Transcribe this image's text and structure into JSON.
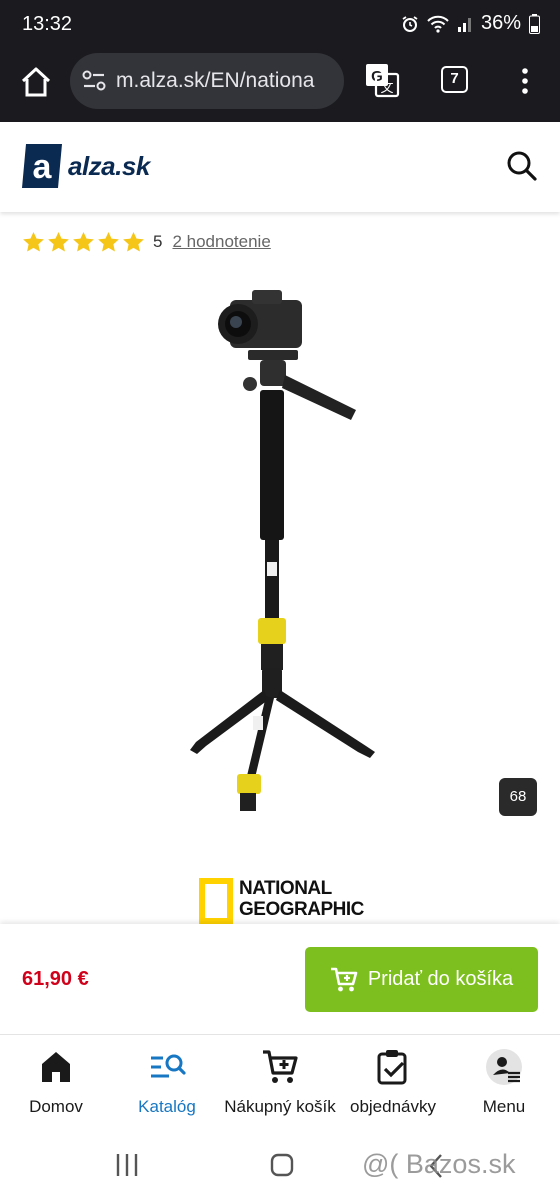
{
  "status_bar": {
    "time": "13:32",
    "battery": "36%",
    "icons": [
      "alarm-icon",
      "wifi-icon",
      "signal-icon",
      "battery-icon"
    ]
  },
  "browser": {
    "url": "m.alza.sk/EN/nationa",
    "tab_count": "7",
    "icons": [
      "home-icon",
      "site-settings-icon",
      "translate-icon",
      "more-vert-icon"
    ]
  },
  "site": {
    "logo_text": "alza.sk",
    "search_icon": "search-icon"
  },
  "rating": {
    "stars": 5,
    "value": "5",
    "link": "2 hodnotenie"
  },
  "gallery": {
    "photo_count": "68"
  },
  "brand": {
    "line1": "NATIONAL",
    "line2": "GEOGRAPHIC"
  },
  "purchase": {
    "price": "61,90 €",
    "cart_label": "Pridať do košíka"
  },
  "bottom_nav": {
    "items": [
      {
        "label": "Domov",
        "icon": "home-icon"
      },
      {
        "label": "Katalóg",
        "icon": "catalog-search-icon"
      },
      {
        "label": "Nákupný košík",
        "icon": "cart-icon"
      },
      {
        "label": "objednávky",
        "icon": "orders-clipboard-icon"
      },
      {
        "label": "Menu",
        "icon": "user-menu-icon"
      }
    ],
    "active": "Katalóg"
  },
  "colors": {
    "accent_green": "#7dbf1e",
    "price_red": "#d0021b",
    "active_blue": "#1777c2",
    "star_yellow": "#f5c518",
    "brand_yellow": "#ffd200"
  },
  "watermark": "@( Bazos.sk"
}
